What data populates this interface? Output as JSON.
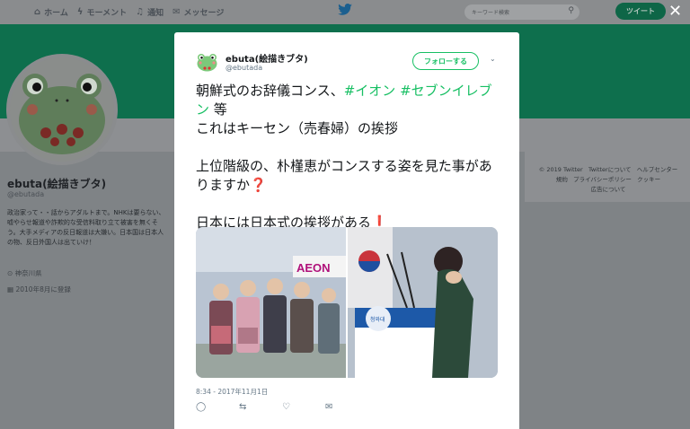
{
  "topnav": {
    "items": [
      {
        "label": "ホーム",
        "icon": "home-icon",
        "glyph": "⌂"
      },
      {
        "label": "モーメント",
        "icon": "moments-icon",
        "glyph": "ϟ"
      },
      {
        "label": "通知",
        "icon": "bell-icon",
        "glyph": "♫"
      },
      {
        "label": "メッセージ",
        "icon": "mail-icon",
        "glyph": "✉"
      }
    ],
    "search_placeholder": "キーワード検索",
    "tweet_button": "ツイート",
    "close_glyph": "✕"
  },
  "profile": {
    "name": "ebuta(絵描きブタ)",
    "handle": "@ebutada",
    "bio": "政治家って・・話からアダルトまで。NHKは要らない、嘘やらせ報道や詐欺的な受信料取り立て被害を無くそう。大手メディアの反日報道は大嫌い。日本国は日本人の物、反日外国人は出ていけ！",
    "location": "神奈川県",
    "joined": "2010年8月に登録"
  },
  "footer": {
    "links": [
      "© 2019 Twitter",
      "Twitterについて",
      "ヘルプセンター",
      "規約",
      "プライバシーポリシー",
      "クッキー",
      "広告について"
    ]
  },
  "modal": {
    "name": "ebuta(絵描きブタ)",
    "handle": "@ebutada",
    "follow_label": "フォローする",
    "tweet": {
      "line1_prefix": "朝鮮式のお辞儀コンス、",
      "hashtag1": "#イオン",
      "hashtag2": "#セブンイレブン",
      "line1_suffix": " 等",
      "line2": "これはキーセン（売春婦）の挨拶",
      "line3": "上位階級の、朴槿恵がコンスする姿を見た事がありますか",
      "line3_emoji": "❓",
      "line4": "日本には日本式の挨拶がある",
      "line4_emoji": "❗"
    },
    "media": {
      "left_logo": "AEON",
      "podium_text": "청와대"
    },
    "timestamp": "8:34 - 2017年11月1日",
    "actions": [
      {
        "name": "reply-icon",
        "glyph": "◯"
      },
      {
        "name": "retweet-icon",
        "glyph": "⇆"
      },
      {
        "name": "like-icon",
        "glyph": "♡"
      },
      {
        "name": "dm-icon",
        "glyph": "✉"
      }
    ]
  },
  "colors": {
    "accent": "#17bf63",
    "banner": "#0e6f4d"
  }
}
